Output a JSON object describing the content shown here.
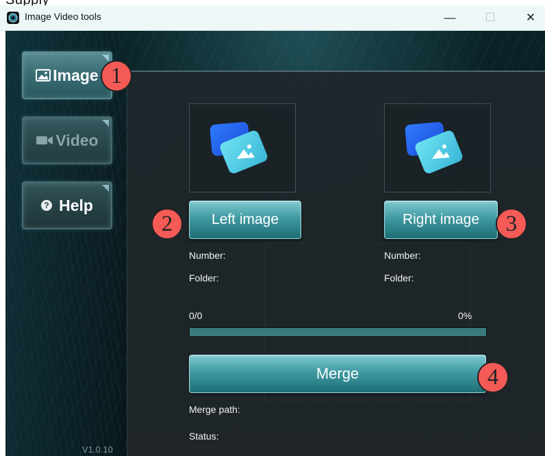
{
  "crop_text": "Supply",
  "window": {
    "title": "Image Video tools",
    "controls": {
      "minimize": "—",
      "maximize": "☐",
      "close": "✕"
    }
  },
  "sidebar": {
    "items": [
      {
        "label": "Image",
        "icon": "image-icon"
      },
      {
        "label": "Video",
        "icon": "video-camera-icon"
      },
      {
        "label": "Help",
        "icon": "question-circle-icon",
        "glyph": "?"
      }
    ],
    "version": "V1.0.10"
  },
  "left": {
    "button": "Left image",
    "number_label": "Number:",
    "folder_label": "Folder:"
  },
  "right": {
    "button": "Right image",
    "number_label": "Number:",
    "folder_label": "Folder:"
  },
  "progress": {
    "count": "0/0",
    "percent": "0%",
    "fraction": 0
  },
  "merge": {
    "button": "Merge",
    "path_label": "Merge path:",
    "status_label": "Status:"
  },
  "callouts": [
    "1",
    "2",
    "3",
    "4"
  ],
  "colors": {
    "accent": "#3f9aa2",
    "callout": "#f45b57",
    "progress_track": "#3b7b7c"
  }
}
